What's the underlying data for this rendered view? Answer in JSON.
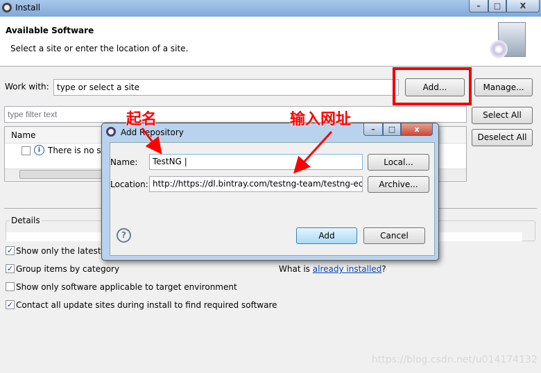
{
  "window": {
    "title": "Install",
    "icon": "eclipse-gear-icon"
  },
  "header": {
    "title": "Available Software",
    "subtitle": "Select a site or enter the location of a site.",
    "icon": "cd-monitor-icon"
  },
  "work_with": {
    "label": "Work with:",
    "value": "type or select a site",
    "add_label": "Add...",
    "manage_label": "Manage..."
  },
  "filter": {
    "placeholder": "type filter text"
  },
  "buttons": {
    "select_all": "Select All",
    "deselect_all": "Deselect All"
  },
  "table": {
    "header": "Name",
    "rows": [
      {
        "text": "There is no s",
        "checked": false,
        "icon": "info-icon"
      }
    ]
  },
  "details": {
    "label": "Details"
  },
  "options": [
    {
      "label": "Show only the latest v",
      "checked": true
    },
    {
      "label": "Group items by category",
      "checked": true
    },
    {
      "label": "Show only software applicable to target environment",
      "checked": false
    },
    {
      "label": "Contact all update sites during install to find required software",
      "checked": true
    }
  ],
  "installed": {
    "prefix": "What is ",
    "link": "already installed",
    "suffix": "?"
  },
  "dialog": {
    "title": "Add Repository",
    "name_label": "Name:",
    "name_value": "TestNG",
    "location_label": "Location:",
    "location_value": "http://https://dl.bintray.com/testng-team/testng-ecli",
    "local_label": "Local...",
    "archive_label": "Archive...",
    "add_label": "Add",
    "cancel_label": "Cancel"
  },
  "annotations": {
    "name_note": "起名",
    "url_note": "输入网址",
    "color": "#ff0000"
  },
  "watermark": "https://blog.csdn.net/u014174132"
}
